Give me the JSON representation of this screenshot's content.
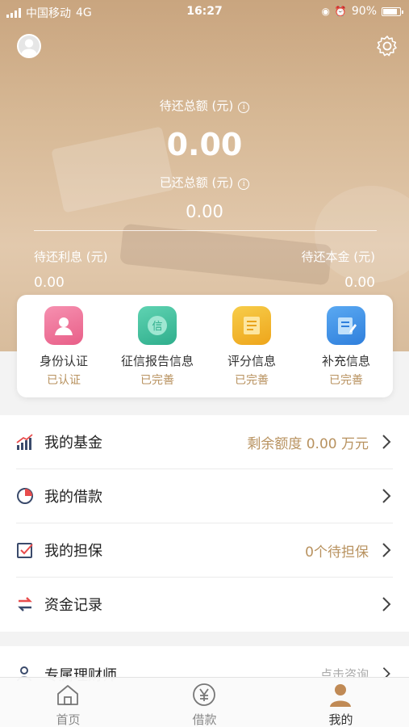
{
  "status_bar": {
    "carrier": "中国移动",
    "network": "4G",
    "time": "16:27",
    "battery": "90%"
  },
  "summary": {
    "pending_total_label": "待还总额 (元)",
    "pending_total_value": "0.00",
    "repaid_total_label": "已还总额 (元)",
    "repaid_total_value": "0.00",
    "pending_interest_label": "待还利息 (元)",
    "pending_interest_value": "0.00",
    "pending_principal_label": "待还本金 (元)",
    "pending_principal_value": "0.00"
  },
  "features": [
    {
      "title": "身份认证",
      "status": "已认证",
      "icon": "id-auth-icon",
      "color": "#ee6f93"
    },
    {
      "title": "征信报告信息",
      "status": "已完善",
      "icon": "credit-report-icon",
      "color": "#3fbf9e"
    },
    {
      "title": "评分信息",
      "status": "已完善",
      "icon": "score-icon",
      "color": "#f2b82a"
    },
    {
      "title": "补充信息",
      "status": "已完善",
      "icon": "supplement-icon",
      "color": "#3d8fe6"
    }
  ],
  "menu": [
    {
      "title": "我的基金",
      "value": "剩余额度 0.00 万元",
      "icon": "fund-chart-icon"
    },
    {
      "title": "我的借款",
      "value": "",
      "icon": "loan-pie-icon"
    },
    {
      "title": "我的担保",
      "value": "0个待担保",
      "icon": "guarantee-icon"
    },
    {
      "title": "资金记录",
      "value": "",
      "icon": "transfer-icon"
    }
  ],
  "advisor": {
    "title": "专属理财师",
    "value": "点击咨询",
    "icon": "person-icon"
  },
  "tabs": [
    {
      "label": "首页",
      "icon": "home-icon"
    },
    {
      "label": "借款",
      "icon": "yen-icon"
    },
    {
      "label": "我的",
      "icon": "profile-icon"
    }
  ],
  "colors": {
    "accent": "#b8925f",
    "hero_bg": "#d7b996"
  }
}
